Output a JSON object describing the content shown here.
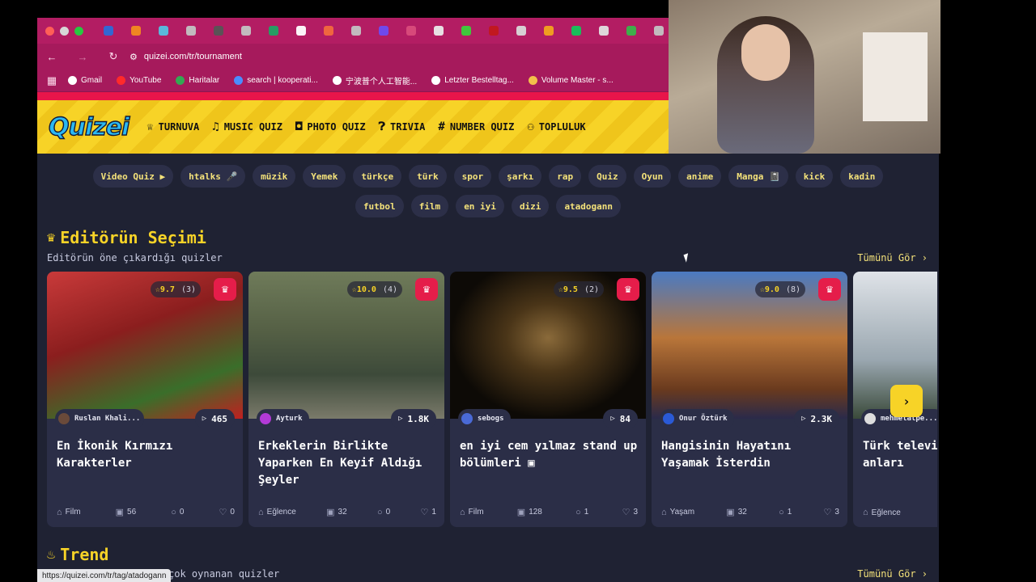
{
  "browser": {
    "url": "quizei.com/tr/tournament",
    "tab_favicon_colors": [
      "#2b6cd9",
      "#f28b1e",
      "#55c0e0",
      "#c3c3c3",
      "#555",
      "#c3c3c3",
      "#1fa463",
      "#fff",
      "#f26a3d",
      "#c3c3c3",
      "#6c4cf2",
      "#d94c7b",
      "#eaeaea",
      "#3ad13a",
      "#c2181c",
      "#d9d9d9",
      "#f2a31e",
      "#12c75a",
      "#e0e0e0",
      "#39b54a",
      "#c3c3c3"
    ],
    "bookmarks": [
      {
        "label": "Gmail",
        "color": "#ffffff"
      },
      {
        "label": "YouTube",
        "color": "#ff2a2a"
      },
      {
        "label": "Haritalar",
        "color": "#34a853"
      },
      {
        "label": "search | kooperati...",
        "color": "#4a8cff"
      },
      {
        "label": "宁波普个人工智能...",
        "color": "#ffffff"
      },
      {
        "label": "Letzter Bestelltag...",
        "color": "#ffffff"
      },
      {
        "label": "Volume Master - s...",
        "color": "#f2c04a"
      }
    ],
    "status_url": "https://quizei.com/tr/tag/atadogann"
  },
  "site": {
    "logo": "Quizei",
    "nav": [
      {
        "label": "TURNUVA",
        "icon": "trophy-icon"
      },
      {
        "label": "MUSIC QUIZ",
        "icon": "music-note-icon"
      },
      {
        "label": "PHOTO QUIZ",
        "icon": "camera-icon"
      },
      {
        "label": "TRIVIA",
        "icon": "question-circle-icon"
      },
      {
        "label": "NUMBER QUIZ",
        "icon": "hash-icon"
      },
      {
        "label": "TOPLULUK",
        "icon": "users-icon"
      }
    ],
    "tags": [
      "Video Quiz ▶",
      "htalks 🎤",
      "müzik",
      "Yemek",
      "türkçe",
      "türk",
      "spor",
      "şarkı",
      "rap",
      "Quiz",
      "Oyun",
      "anime",
      "Manga 📓",
      "kick",
      "kadin",
      "futbol",
      "film",
      "en iyi",
      "dizi",
      "atadogann"
    ]
  },
  "editor_section": {
    "title": "Editörün Seçimi",
    "subtitle": "Editörün öne çıkardığı quizler",
    "see_all": "Tümünü Gör ›"
  },
  "trend_section": {
    "title": "Trend",
    "subtitle": "çok oynanan quizler",
    "see_all": "Tümünü Gör ›"
  },
  "cards": [
    {
      "rating": "9.7",
      "count": "(3)",
      "author": "Ruslan Khali...",
      "plays": "465",
      "title": "En İkonik Kırmızı Karakterler",
      "category": "Film",
      "questions": "56",
      "comments": "0",
      "likes": "0",
      "thumb": "linear-gradient(160deg,#c93a3a,#8b1e1e 40%,#3a6e2a 75%,#c02020)",
      "avatar": "#6a4a3a"
    },
    {
      "rating": "10.0",
      "count": "(4)",
      "author": "Ayturk",
      "plays": "1.8K",
      "title": "Erkeklerin Birlikte Yaparken En Keyif Aldığı Şeyler",
      "category": "Eğlence",
      "questions": "32",
      "comments": "0",
      "likes": "1",
      "thumb": "linear-gradient(180deg,#6f7b5a,#556045 40%,#3d4a3a 70%,#7a7a6a)",
      "avatar": "#b23ad6"
    },
    {
      "rating": "9.5",
      "count": "(2)",
      "author": "sebogs",
      "plays": "84",
      "title": "en iyi cem yılmaz stand up bölümleri ▣",
      "category": "Film",
      "questions": "128",
      "comments": "1",
      "likes": "3",
      "thumb": "radial-gradient(ellipse at 50% 45%,#8a6a3a 0%,#4a3518 30%,#0d0a06 70%)",
      "avatar": "#4a6ad6"
    },
    {
      "rating": "9.0",
      "count": "(8)",
      "author": "Onur Öztürk",
      "plays": "2.3K",
      "title": "Hangisinin Hayatını Yaşamak İsterdin",
      "category": "Yaşam",
      "questions": "32",
      "comments": "1",
      "likes": "3",
      "thumb": "linear-gradient(180deg,#4a7ac2,#b9763a 45%,#6a3a1e 80%,#2a2a4a)",
      "avatar": "#2a5ad6"
    },
    {
      "rating": "",
      "count": "",
      "author": "mehmetalpe...",
      "plays": "",
      "title": "Türk televizyon tarihinin anları",
      "category": "Eğlence",
      "questions": "",
      "comments": "",
      "likes": "",
      "thumb": "linear-gradient(180deg,#dfe3e8,#9aa7b0 60%,#3a4a3a)",
      "avatar": "#dddddd"
    }
  ],
  "icons": {
    "star": "☆",
    "crown": "♛",
    "play": "▷",
    "tag": "⌂",
    "gallery": "▣",
    "comment": "○",
    "heart": "♡",
    "next": "›"
  }
}
